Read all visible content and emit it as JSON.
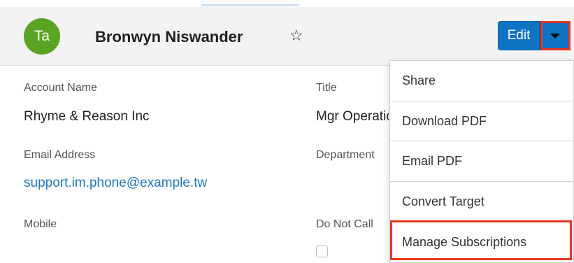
{
  "record": {
    "avatar_initials": "Ta",
    "name": "Bronwyn Niswander",
    "favorite_icon": "star-outline-icon"
  },
  "actions": {
    "edit_label": "Edit",
    "dropdown_icon": "caret-down-icon"
  },
  "fields": {
    "account_name": {
      "label": "Account Name",
      "value": "Rhyme & Reason Inc"
    },
    "title": {
      "label": "Title",
      "value": "Mgr Operations"
    },
    "email": {
      "label": "Email Address",
      "value": "support.im.phone@example.tw"
    },
    "department": {
      "label": "Department",
      "value": ""
    },
    "mobile": {
      "label": "Mobile",
      "value": ""
    },
    "do_not_call": {
      "label": "Do Not Call",
      "checked": false
    }
  },
  "actions_menu": {
    "items": [
      {
        "label": "Share"
      },
      {
        "label": "Download PDF"
      },
      {
        "label": "Email PDF"
      },
      {
        "label": "Convert Target"
      },
      {
        "label": "Manage Subscriptions"
      }
    ]
  },
  "colors": {
    "avatar": "#5aa424",
    "primary_button": "#0f73c6",
    "link": "#1a77c9",
    "highlight": "#e8351f"
  }
}
